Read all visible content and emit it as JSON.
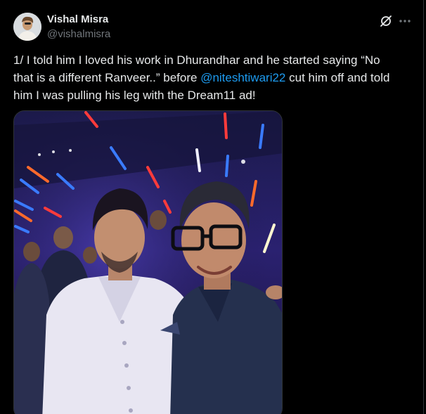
{
  "author": {
    "display_name": "Vishal Misra",
    "handle": "@vishalmisra",
    "avatar_icon": "profile-photo"
  },
  "actions": {
    "grok_icon": "grok-icon",
    "more_icon": "more-dots-icon"
  },
  "tweet": {
    "line1": "1/ I told him I loved his work in Dhurandhar and he started saying “No",
    "line2_before": "that is a different Ranveer..” before ",
    "mention": "@niteshtiwari22",
    "line2_after": " cut him off and told",
    "line3": "him I was pulling his leg with the Dream11 ad!"
  },
  "media": {
    "type": "photo",
    "description_icon": "event-selfie-photo"
  },
  "colors": {
    "background": "#000000",
    "text": "#e7e9ea",
    "secondary_text": "#71767b",
    "link": "#1d9bf0",
    "border": "#2f3336"
  }
}
